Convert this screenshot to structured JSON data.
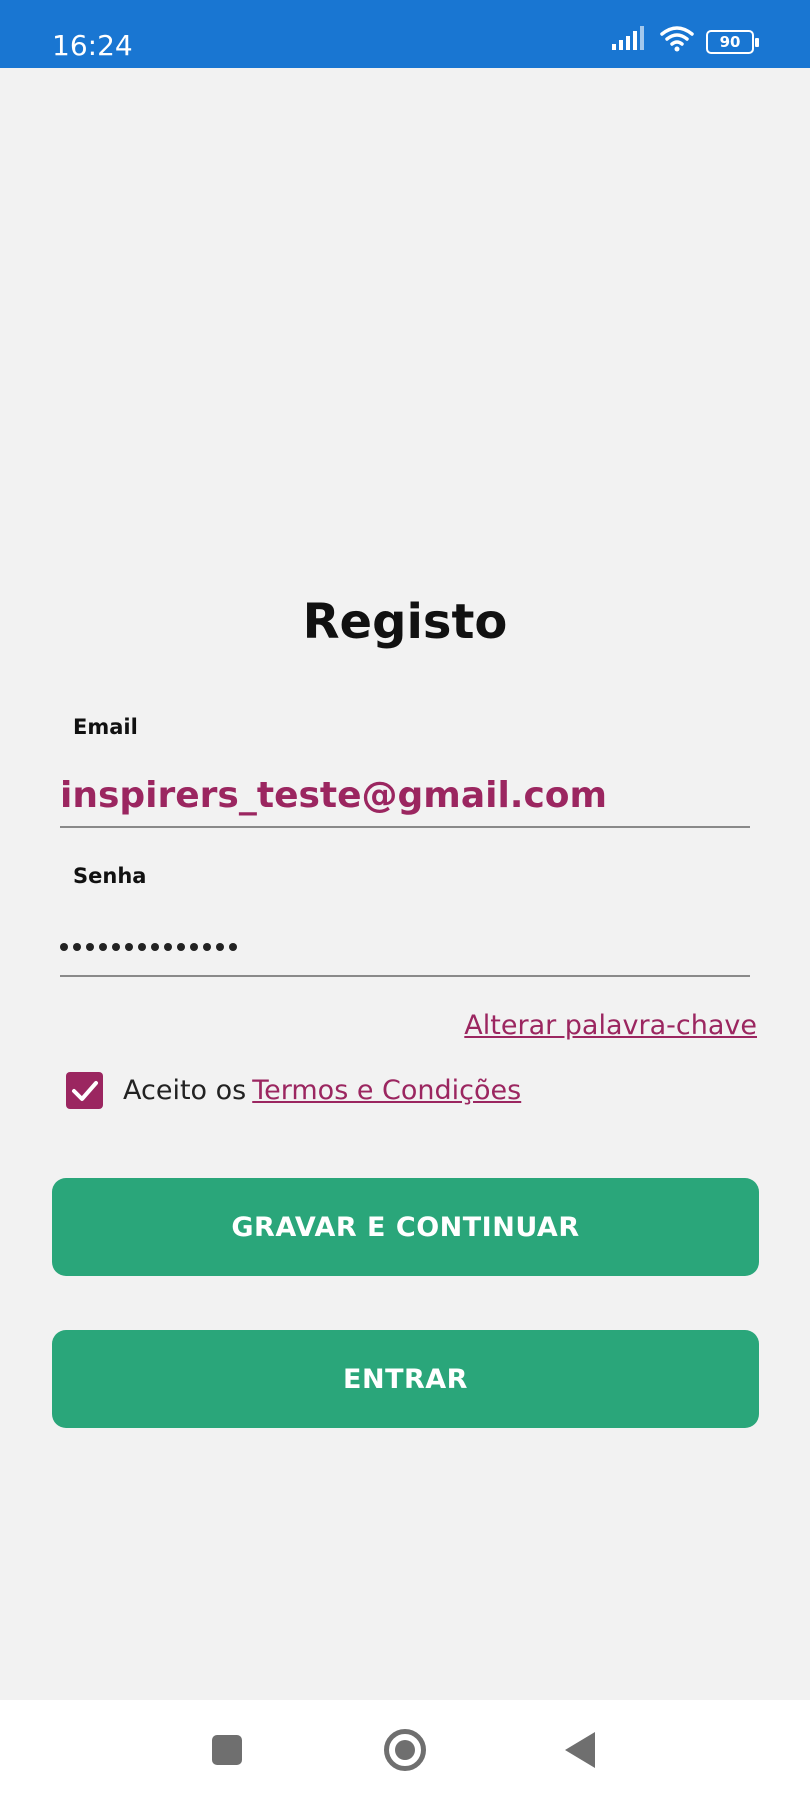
{
  "status_bar": {
    "time": "16:24",
    "battery": "90",
    "icons": [
      "signal-icon",
      "wifi-icon",
      "battery-icon"
    ],
    "color": "#1976d2"
  },
  "page": {
    "title": "Registo"
  },
  "form": {
    "email_label": "Email",
    "email_value": "inspirers_teste@gmail.com",
    "password_label": "Senha",
    "password_length": 14,
    "change_password_link": "Alterar palavra-chave",
    "terms_prefix": "Aceito os",
    "terms_link": "Termos e Condições",
    "terms_checked": true
  },
  "buttons": {
    "save_continue": "GRAVAR E CONTINUAR",
    "enter": "ENTRAR"
  },
  "colors": {
    "accent": "#9b2660",
    "button": "#2aa67a",
    "background": "#f2f2f2"
  },
  "nav_bar": {
    "icons": [
      "recent-apps-icon",
      "home-icon",
      "back-icon"
    ]
  }
}
